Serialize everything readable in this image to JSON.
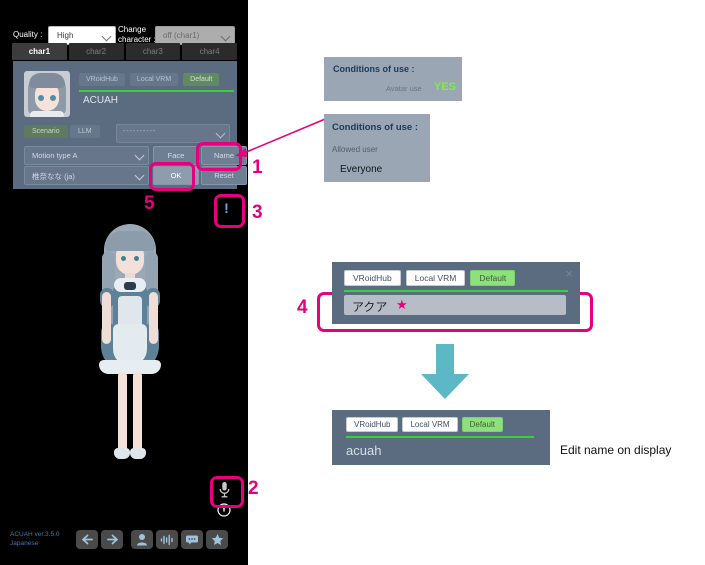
{
  "app": {
    "quality_label": "Quality :",
    "quality_value": "High",
    "change_character_label": "Change character :",
    "change_character_value": "off (char1)",
    "char_tabs": [
      {
        "label": "char1",
        "active": true
      },
      {
        "label": "char2",
        "active": false
      },
      {
        "label": "char3",
        "active": false
      },
      {
        "label": "char4",
        "active": false
      }
    ],
    "panel": {
      "source_tabs": [
        "VRoidHub",
        "Local VRM",
        "Default"
      ],
      "active_source_tab": "Default",
      "character_name": "ACUAH",
      "mode_scenario": "Scenario",
      "mode_llm": "LLM",
      "scenario_value": "----------",
      "motion_value": "Motion type A",
      "voice_value": "椎奈なな (ja)",
      "btn_face": "Face",
      "btn_name": "Name",
      "btn_ok": "OK",
      "btn_reset": "Reset"
    },
    "info_badge": "!",
    "version_line1": "ACUAH ver.3.5.0",
    "version_line2": "Japanese",
    "toolbar_icons": [
      "back-arrow",
      "forward-arrow",
      "person",
      "voice-wave",
      "chat",
      "star"
    ],
    "mic_icon": "microphone",
    "power_icon": "power"
  },
  "conditions_a": {
    "title": "Conditions of use :",
    "key": "Avatar use",
    "value": "YES",
    "value_color": "#7cf03a"
  },
  "conditions_b": {
    "title": "Conditions of use :",
    "key": "Allowed user",
    "value": "Everyone"
  },
  "figure4": {
    "tabs": [
      "VRoidHub",
      "Local VRM",
      "Default"
    ],
    "active_tab": "Default",
    "input_value": "アクア",
    "star_glyph": "★",
    "close_glyph": "×"
  },
  "figure5": {
    "tabs": [
      "VRoidHub",
      "Local VRM",
      "Default"
    ],
    "active_tab": "Default",
    "display_name": "acuah",
    "caption": "Edit name on display"
  },
  "markers": {
    "m1": "1",
    "m2": "2",
    "m3": "3",
    "m4": "4",
    "m5": "5"
  },
  "colors": {
    "accent_pink": "#e5007e",
    "panel_blue": "#5b6b80",
    "green_rule": "#3ccf3c",
    "teal_arrow": "#5cb8c4"
  }
}
